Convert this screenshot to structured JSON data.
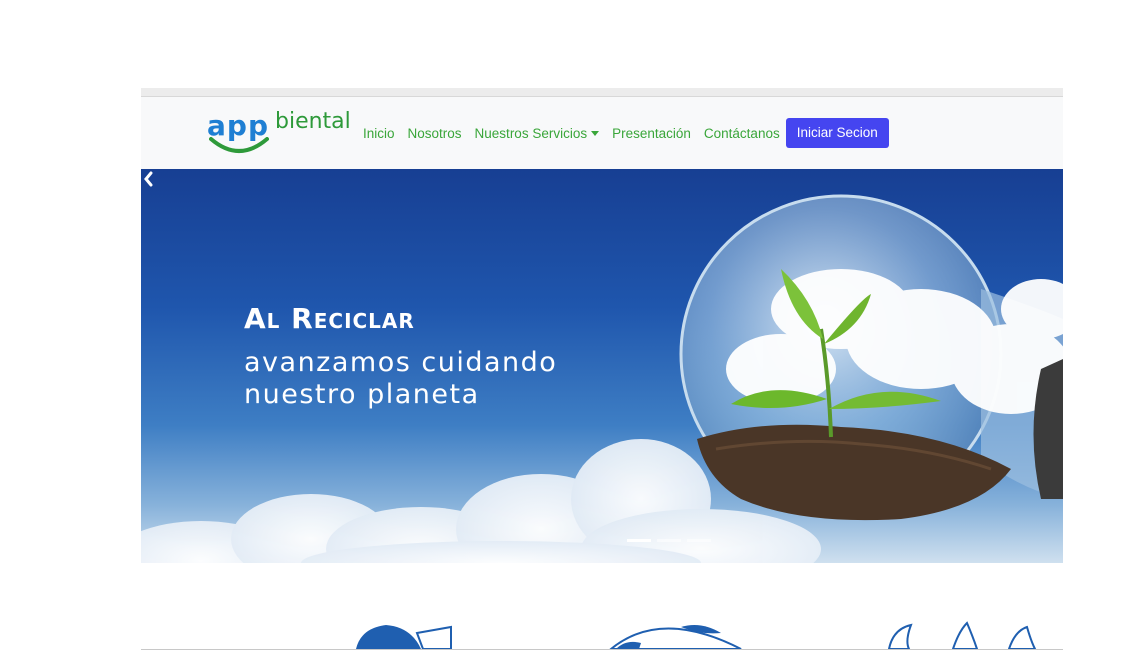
{
  "brand": {
    "logo_part_a": "app",
    "logo_part_b": "biental",
    "colors": {
      "logo_blue": "#1f7fd3",
      "logo_green": "#2e9a3a",
      "nav_green": "#3aa63a",
      "button_blue": "#4545f0"
    }
  },
  "nav": {
    "items": [
      {
        "label": "Inicio"
      },
      {
        "label": "Nosotros"
      },
      {
        "label": "Nuestros Servicios",
        "has_dropdown": true
      },
      {
        "label": "Presentación"
      },
      {
        "label": "Contáctanos"
      }
    ],
    "login_label": "Iniciar Secion"
  },
  "hero": {
    "title": "Al Reciclar",
    "subtitle": "avanzamos cuidando nuestro planeta",
    "prev_icon": "chevron-left-icon",
    "slides_total": 3,
    "active_slide": 1
  }
}
